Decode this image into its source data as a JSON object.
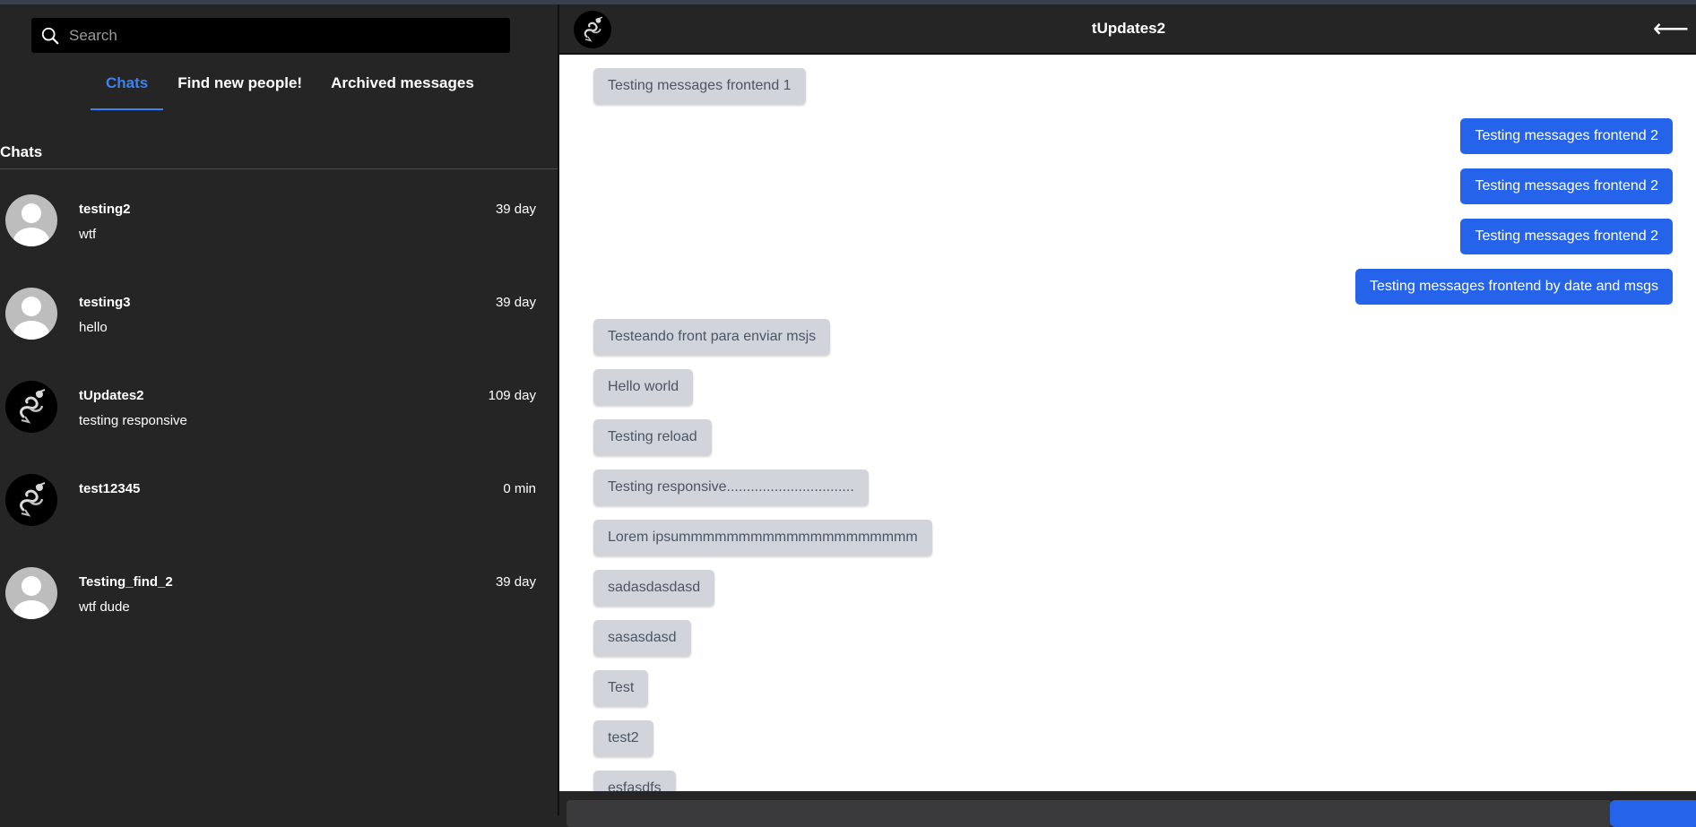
{
  "search": {
    "placeholder": "Search"
  },
  "tabs": [
    {
      "label": "Chats"
    },
    {
      "label": "Find new people!"
    },
    {
      "label": "Archived messages"
    }
  ],
  "section_title": "Chats",
  "chats": [
    {
      "name": "testing2",
      "time": "39 day",
      "preview": "wtf",
      "avatar": "default-user-avatar"
    },
    {
      "name": "testing3",
      "time": "39 day",
      "preview": "hello",
      "avatar": "default-user-avatar"
    },
    {
      "name": "tUpdates2",
      "time": "109 day",
      "preview": "testing responsive",
      "avatar": "dragon-avatar"
    },
    {
      "name": "test12345",
      "time": "0 min",
      "preview": "",
      "avatar": "dragon-avatar"
    },
    {
      "name": "Testing_find_2",
      "time": "39 day",
      "preview": "wtf dude",
      "avatar": "default-user-avatar"
    }
  ],
  "conversation": {
    "title": "tUpdates2",
    "back_icon": "arrow-left-icon",
    "messages": [
      {
        "text": "Testing messages frontend 1",
        "dir": "in"
      },
      {
        "text": "Testing messages frontend 2",
        "dir": "out"
      },
      {
        "text": "Testing messages frontend 2",
        "dir": "out"
      },
      {
        "text": "Testing messages frontend 2",
        "dir": "out"
      },
      {
        "text": "Testing messages frontend by date and msgs",
        "dir": "out"
      },
      {
        "text": "Testeando front para enviar msjs",
        "dir": "in"
      },
      {
        "text": "Hello world",
        "dir": "in"
      },
      {
        "text": "Testing reload",
        "dir": "in"
      },
      {
        "text": "Testing responsive................................",
        "dir": "in"
      },
      {
        "text": "Lorem ipsummmmmmmmmmmmmmmmmmmm",
        "dir": "in"
      },
      {
        "text": "sadasdasdasd",
        "dir": "in"
      },
      {
        "text": "sasasdasd",
        "dir": "in"
      },
      {
        "text": "Test",
        "dir": "in"
      },
      {
        "text": "test2",
        "dir": "in"
      },
      {
        "text": "esfasdfs",
        "dir": "in"
      }
    ]
  },
  "colors": {
    "accent": "#2563eb",
    "panel": "#252526",
    "bubble_in": "#d1d5db"
  }
}
